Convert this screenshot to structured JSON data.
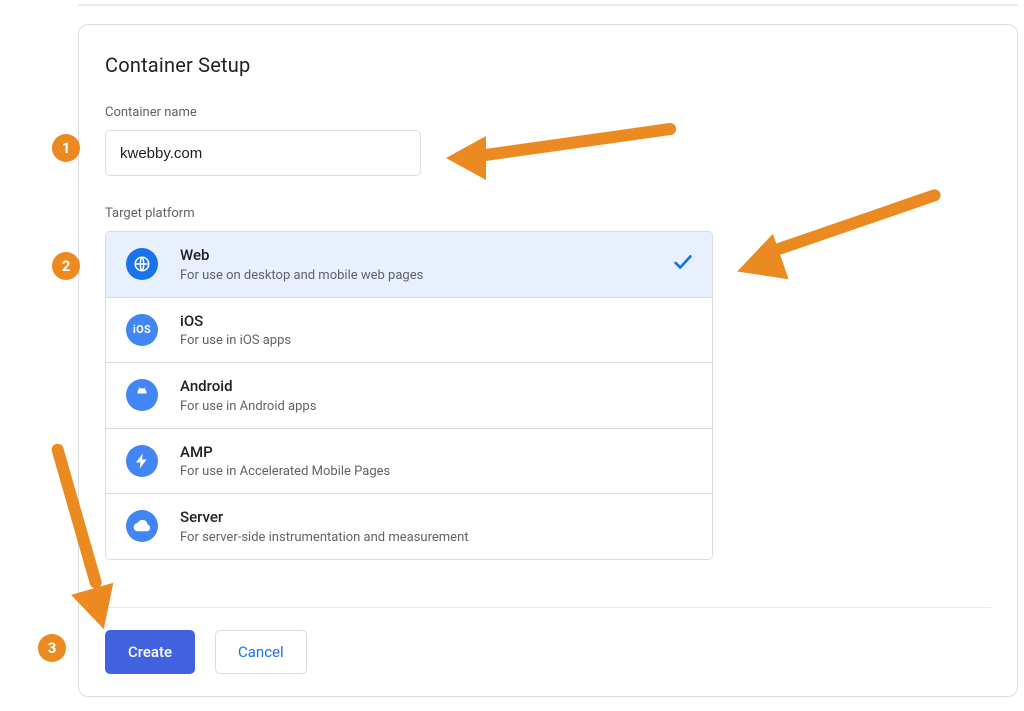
{
  "colors": {
    "accent": "#1a73e8",
    "marker": "#ec8a22"
  },
  "steps": {
    "s1": "1",
    "s2": "2",
    "s3": "3"
  },
  "header": {
    "title": "Container Setup"
  },
  "form": {
    "container_name_label": "Container name",
    "container_name_value": "kwebby.com",
    "target_platform_label": "Target platform"
  },
  "platforms": {
    "web": {
      "title": "Web",
      "subtitle": "For use on desktop and mobile web pages",
      "selected": true
    },
    "ios": {
      "title": "iOS",
      "subtitle": "For use in iOS apps"
    },
    "android": {
      "title": "Android",
      "subtitle": "For use in Android apps"
    },
    "amp": {
      "title": "AMP",
      "subtitle": "For use in Accelerated Mobile Pages"
    },
    "server": {
      "title": "Server",
      "subtitle": "For server-side instrumentation and measurement"
    }
  },
  "icons": {
    "web": "globe-icon",
    "ios": "ios-icon",
    "android": "android-icon",
    "amp": "bolt-icon",
    "server": "cloud-icon",
    "check": "check-icon"
  },
  "footer": {
    "create_label": "Create",
    "cancel_label": "Cancel"
  }
}
